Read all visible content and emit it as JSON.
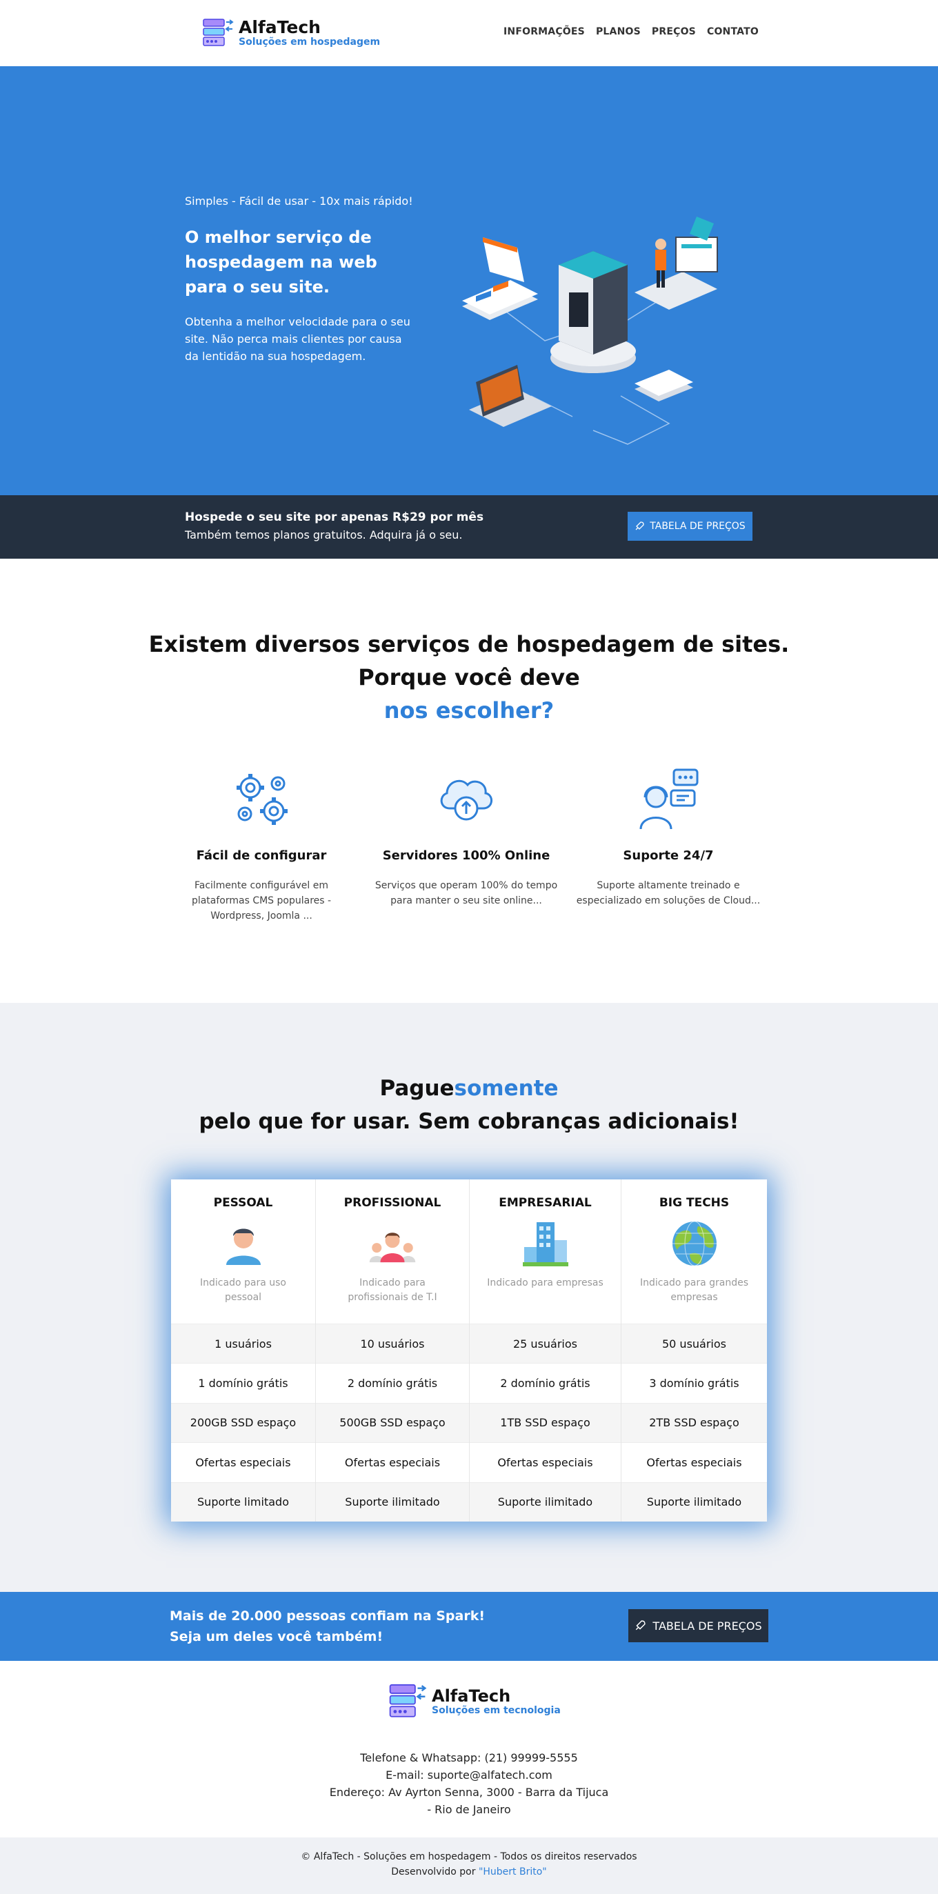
{
  "header": {
    "logo_title": "AlfaTech",
    "logo_subtitle": "Soluções em hospedagem",
    "nav": [
      "INFORMAÇÕES",
      "PLANOS",
      "PREÇOS",
      "CONTATO"
    ]
  },
  "hero": {
    "kicker": "Simples - Fácil de usar - 10x mais rápido!",
    "title": "O melhor serviço de hospedagem na web para o seu site.",
    "text": "Obtenha a melhor velocidade para o seu site. Não perca mais clientes por causa da lentidão na sua hospedagem."
  },
  "cta_dark": {
    "line1": "Hospede o seu site por apenas R$29 por mês",
    "line2": "Também temos planos gratuitos. Adquira já o seu.",
    "button": "TABELA DE PREÇOS"
  },
  "why": {
    "line1": "Existem diversos serviços de hospedagem de sites.",
    "line2": "Porque você deve",
    "line3": "nos escolher?",
    "features": [
      {
        "icon": "gears-icon",
        "title": "Fácil de configurar",
        "text": "Facilmente configurável em plataformas CMS populares - Wordpress, Joomla ..."
      },
      {
        "icon": "cloud-upload-icon",
        "title": "Servidores 100% Online",
        "text": "Serviços que operam 100% do tempo para manter o seu site online..."
      },
      {
        "icon": "support-agent-icon",
        "title": "Suporte 24/7",
        "text": "Suporte altamente treinado e especializado em soluções de Cloud..."
      }
    ]
  },
  "pricing": {
    "title_a": "Pague",
    "title_b": "somente",
    "title_c": "pelo que for usar. Sem cobranças adicionais!",
    "plans": [
      {
        "name": "PESSOAL",
        "icon": "person-icon",
        "desc": "Indicado para uso pessoal",
        "rows": [
          "1 usuários",
          "1 domínio grátis",
          "200GB SSD espaço",
          "Ofertas especiais",
          "Suporte limitado"
        ]
      },
      {
        "name": "PROFISSIONAL",
        "icon": "team-icon",
        "desc": "Indicado para profissionais de T.I",
        "rows": [
          "10 usuários",
          "2 domínio grátis",
          "500GB SSD espaço",
          "Ofertas especiais",
          "Suporte ilimitado"
        ]
      },
      {
        "name": "EMPRESARIAL",
        "icon": "building-icon",
        "desc": "Indicado para empresas",
        "rows": [
          "25 usuários",
          "2 domínio grátis",
          "1TB SSD espaço",
          "Ofertas especiais",
          "Suporte ilimitado"
        ]
      },
      {
        "name": "BIG TECHS",
        "icon": "globe-icon",
        "desc": "Indicado para grandes empresas",
        "rows": [
          "50 usuários",
          "3 domínio grátis",
          "2TB SSD espaço",
          "Ofertas especiais",
          "Suporte ilimitado"
        ]
      }
    ]
  },
  "cta_blue": {
    "line1": "Mais de 20.000 pessoas confiam na Spark!",
    "line2": "Seja um deles você também!",
    "button": "TABELA DE PREÇOS"
  },
  "footer": {
    "logo_title": "AlfaTech",
    "logo_subtitle": "Soluções em tecnologia",
    "phone": "Telefone & Whatsapp: (21) 99999-5555",
    "email": "E-mail: suporte@alfatech.com",
    "address": "Endereço: Av Ayrton Senna, 3000 - Barra da Tijuca",
    "city": "- Rio de Janeiro",
    "copyright": "© AlfaTech - Soluções em hospedagem - Todos os direitos reservados",
    "dev_prefix": "Desenvolvido por",
    "dev_name": "\"Hubert Brito\""
  },
  "colors": {
    "primary": "#3282d8",
    "dark": "#243040",
    "light_bg": "#eff1f5"
  }
}
